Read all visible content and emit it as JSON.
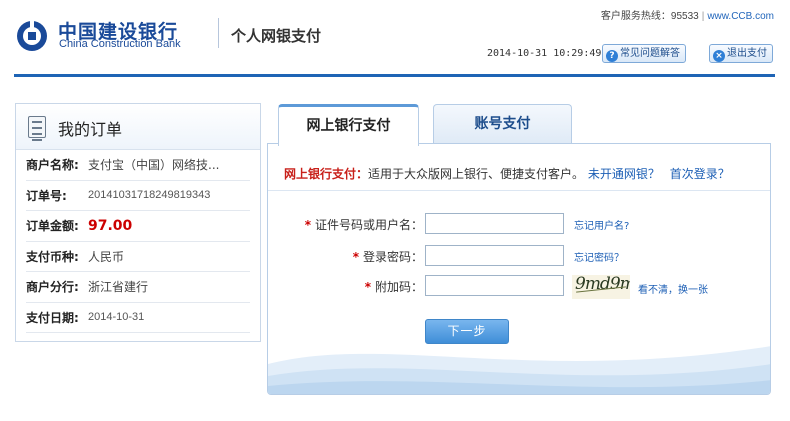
{
  "header": {
    "bank_name_cn": "中国建设银行",
    "bank_name_en": "China Construction Bank",
    "service_title": "个人网银支付",
    "hotline_label": "客户服务热线：95533",
    "website": "www.CCB.com",
    "datetime": "2014-10-31 10:29:49",
    "faq_button": "常见问题解答",
    "exit_button": "退出支付",
    "logo_icon": "ccb-logo-icon",
    "faq_icon": "question-icon",
    "exit_icon": "close-icon"
  },
  "order": {
    "title": "我的订单",
    "icon": "clipboard-icon",
    "rows": [
      {
        "label": "商户名称:",
        "value": "支付宝（中国）网络技..."
      },
      {
        "label": "订单号:",
        "value": "20141031718249819343"
      },
      {
        "label": "订单金额:",
        "value": "97.00"
      },
      {
        "label": "支付币种:",
        "value": "人民币"
      },
      {
        "label": "商户分行:",
        "value": "浙江省建行"
      },
      {
        "label": "支付日期:",
        "value": "2014-10-31"
      }
    ]
  },
  "tabs": [
    {
      "label": "网上银行支付",
      "active": true
    },
    {
      "label": "账号支付",
      "active": false
    }
  ],
  "payment": {
    "info_label": "网上银行支付：",
    "info_text": "适用于大众版网上银行、便捷支付客户。",
    "link_not_open": "未开通网银？",
    "link_first_login": "首次登录？",
    "fields": {
      "username": {
        "label": "证件号码或用户名：",
        "value": "",
        "link": "忘记用户名?"
      },
      "password": {
        "label": "登录密码：",
        "value": "",
        "link": "忘记密码？"
      },
      "captcha": {
        "label": "附加码：",
        "value": "",
        "image_text": "9md9m",
        "link": "看不清，换一张"
      }
    },
    "required_mark": "*",
    "submit_button": "下一步"
  },
  "colors": {
    "brand_blue": "#1a4a99",
    "rule_blue": "#1e64b5",
    "accent_red": "#cc0000",
    "link_blue": "#1d5fb5"
  }
}
